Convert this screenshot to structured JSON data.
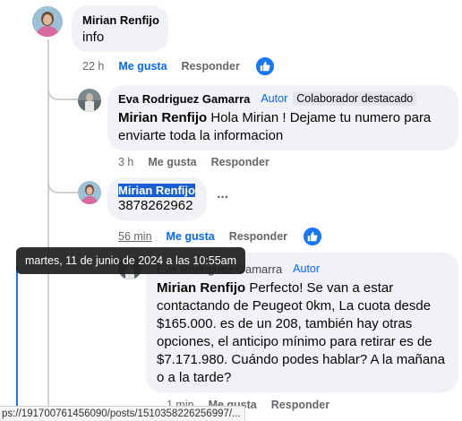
{
  "comments": [
    {
      "author": "Mirian Renfijo",
      "text": "info",
      "time": "22 h",
      "like_label": "Me gusta",
      "reply_label": "Responder"
    },
    {
      "author": "Eva Rodriguez Gamarra",
      "badge_author": "Autor",
      "badge_top": "Colaborador destacado",
      "mention": "Mirian Renfijo",
      "text": " Hola Mirian ! Dejame tu numero para enviarte toda la informacion",
      "time": "3 h",
      "like_label": "Me gusta",
      "reply_label": "Responder"
    },
    {
      "author": "Mirian Renfijo",
      "text": "3878262962",
      "time": "56 min",
      "like_label": "Me gusta",
      "reply_label": "Responder",
      "more_label": "···"
    },
    {
      "author": "Eva Rodriguez Gamarra",
      "badge_author": "Autor",
      "mention": "Mirian Renfijo",
      "text": " Perfecto! Se van a estar contactando de Peugeot 0km, La cuota desde $165.000. es de un 208, también hay otras opciones, el anticipo mínimo para retirar es de $7.171.980. Cuándo podes hablar? A la mañana o a la tarde?",
      "time": "1 min",
      "like_label": "Me gusta",
      "reply_label": "Responder"
    }
  ],
  "tooltip": "martes, 11 de junio de 2024 a las 10:55am",
  "status_url": "ps://191700761456090/posts/1510358226256997/...",
  "colors": {
    "accent": "#0866ff",
    "like": "#1877f2",
    "bubble": "#f0f2f5"
  },
  "icons": {
    "like": "thumbs-up-icon"
  }
}
